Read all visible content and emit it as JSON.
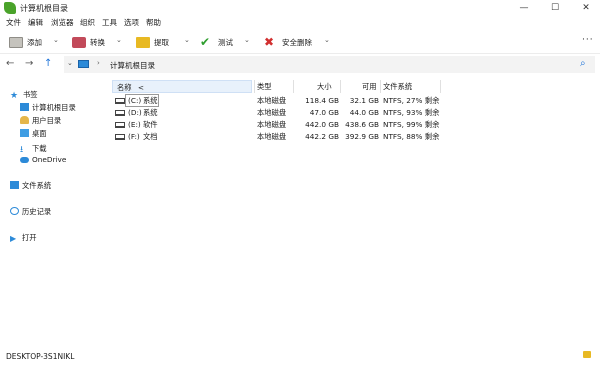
{
  "window": {
    "title": "计算机根目录",
    "controls": {
      "minimize": "—",
      "maximize": "☐",
      "close": "✕"
    }
  },
  "menu": [
    "文件",
    "编辑",
    "浏览器",
    "组织",
    "工具",
    "选项",
    "帮助"
  ],
  "toolbar": {
    "add": "添加",
    "convert": "转换",
    "extract": "提取",
    "test": "测试",
    "delete": "安全删除",
    "more": "···"
  },
  "address": {
    "path": "计算机根目录"
  },
  "sidebar": {
    "bookmarks": "书签",
    "items": [
      {
        "label": "计算机根目录",
        "icon": "computer-icon"
      },
      {
        "label": "用户目录",
        "icon": "user-folder-icon"
      },
      {
        "label": "桌面",
        "icon": "desktop-icon"
      },
      {
        "label": "下载",
        "icon": "download-icon"
      },
      {
        "label": "OneDrive",
        "icon": "cloud-icon"
      }
    ],
    "filesystem": "文件系统",
    "history": "历史记录",
    "open": "打开"
  },
  "columns": {
    "name": "名称",
    "sort_indicator": "<",
    "type": "类型",
    "size": "大小",
    "free": "可用",
    "fs": "文件系统"
  },
  "drives": [
    {
      "letter": "(C:)",
      "label": "系统",
      "type": "本地磁盘",
      "size": "118.4 GB",
      "free": "32.1 GB",
      "fs": "NTFS, 27% 剩余"
    },
    {
      "letter": "(D:)",
      "label": "系统",
      "type": "本地磁盘",
      "size": "47.0 GB",
      "free": "44.0 GB",
      "fs": "NTFS, 93% 剩余"
    },
    {
      "letter": "(E:)",
      "label": "软件",
      "type": "本地磁盘",
      "size": "442.0 GB",
      "free": "438.6 GB",
      "fs": "NTFS, 99% 剩余"
    },
    {
      "letter": "(F:)",
      "label": "文档",
      "type": "本地磁盘",
      "size": "442.2 GB",
      "free": "392.9 GB",
      "fs": "NTFS, 88% 剩余"
    }
  ],
  "status": {
    "computer": "DESKTOP-3S1NIKL"
  }
}
